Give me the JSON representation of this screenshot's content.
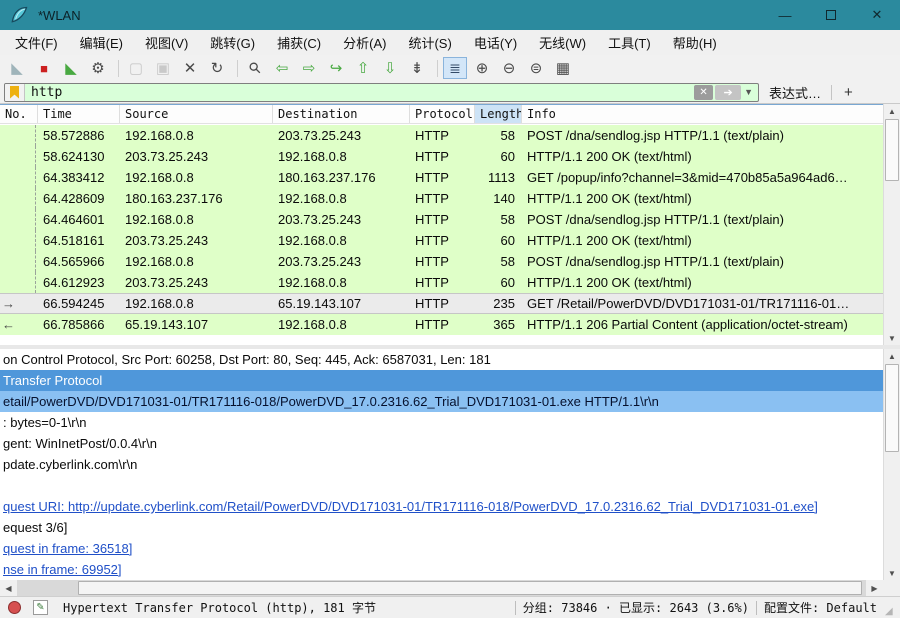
{
  "window": {
    "title": "*WLAN",
    "minimize": "—",
    "close": "✕"
  },
  "menu": {
    "items": [
      {
        "name": "menu-file",
        "label": "文件(F)"
      },
      {
        "name": "menu-edit",
        "label": "编辑(E)"
      },
      {
        "name": "menu-view",
        "label": "视图(V)"
      },
      {
        "name": "menu-go",
        "label": "跳转(G)"
      },
      {
        "name": "menu-capture",
        "label": "捕获(C)"
      },
      {
        "name": "menu-analyze",
        "label": "分析(A)"
      },
      {
        "name": "menu-statistics",
        "label": "统计(S)"
      },
      {
        "name": "menu-telephony",
        "label": "电话(Y)"
      },
      {
        "name": "menu-wireless",
        "label": "无线(W)"
      },
      {
        "name": "menu-tools",
        "label": "工具(T)"
      },
      {
        "name": "menu-help",
        "label": "帮助(H)"
      }
    ]
  },
  "toolbar": {
    "icons": [
      {
        "name": "start-capture-icon",
        "glyph": "◣",
        "classes": [
          "tint-muted"
        ]
      },
      {
        "name": "stop-capture-icon",
        "glyph": "■",
        "classes": [
          "tint-red"
        ]
      },
      {
        "name": "restart-capture-icon",
        "glyph": "◣",
        "classes": [
          "tint-green"
        ]
      },
      {
        "name": "capture-options-icon",
        "glyph": "⚙",
        "classes": [
          "tint-dark"
        ]
      },
      {
        "name": "toolbar-separator",
        "glyph": "",
        "classes": [
          "sep"
        ],
        "interactable": false
      },
      {
        "name": "open-file-icon",
        "glyph": "▢",
        "classes": [
          "disabled"
        ]
      },
      {
        "name": "save-file-icon",
        "glyph": "▣",
        "classes": [
          "disabled"
        ]
      },
      {
        "name": "close-file-icon",
        "glyph": "✕",
        "classes": [
          "tint-dark"
        ]
      },
      {
        "name": "reload-file-icon",
        "glyph": "↻",
        "classes": [
          "tint-dark"
        ]
      },
      {
        "name": "toolbar-separator",
        "glyph": "",
        "classes": [
          "sep"
        ],
        "interactable": false
      },
      {
        "name": "find-packet-icon",
        "glyph": "⚲",
        "classes": [
          "tint-dark"
        ]
      },
      {
        "name": "go-back-icon",
        "glyph": "⇦",
        "classes": [
          "tint-green"
        ]
      },
      {
        "name": "go-forward-icon",
        "glyph": "⇨",
        "classes": [
          "tint-green"
        ]
      },
      {
        "name": "go-to-packet-icon",
        "glyph": "↪",
        "classes": [
          "tint-green"
        ]
      },
      {
        "name": "go-up-icon",
        "glyph": "⇧",
        "classes": [
          "tint-green"
        ]
      },
      {
        "name": "go-down-icon",
        "glyph": "⇩",
        "classes": [
          "tint-green"
        ]
      },
      {
        "name": "go-bottom-icon",
        "glyph": "⇟",
        "classes": [
          "tint-dark"
        ]
      },
      {
        "name": "toolbar-separator",
        "glyph": "",
        "classes": [
          "sep"
        ],
        "interactable": false
      },
      {
        "name": "colorize-icon",
        "glyph": "≣",
        "classes": [
          "selected"
        ]
      },
      {
        "name": "zoom-in-icon",
        "glyph": "⊕",
        "classes": [
          "tint-dark"
        ]
      },
      {
        "name": "zoom-out-icon",
        "glyph": "⊖",
        "classes": [
          "tint-dark"
        ]
      },
      {
        "name": "zoom-reset-icon",
        "glyph": "⊜",
        "classes": [
          "tint-dark"
        ]
      },
      {
        "name": "resize-columns-icon",
        "glyph": "▦",
        "classes": [
          "tint-dark"
        ]
      }
    ]
  },
  "filter": {
    "value": "http",
    "clear_glyph": "✕",
    "apply_glyph": "➔",
    "caret_glyph": "▼",
    "expression_label": "表达式…",
    "add_label": "+"
  },
  "packet_list": {
    "columns": [
      "No.",
      "Time",
      "Source",
      "Destination",
      "Protocol",
      "Length",
      "Info"
    ],
    "rows": [
      {
        "marker": "",
        "classes": [
          "dashed"
        ],
        "time": "58.572886",
        "source": "192.168.0.8",
        "destination": "203.73.25.243",
        "protocol": "HTTP",
        "length": "58",
        "info": "POST /dna/sendlog.jsp HTTP/1.1  (text/plain)"
      },
      {
        "marker": "",
        "classes": [
          "dashed"
        ],
        "time": "58.624130",
        "source": "203.73.25.243",
        "destination": "192.168.0.8",
        "protocol": "HTTP",
        "length": "60",
        "info": "HTTP/1.1 200 OK  (text/html)"
      },
      {
        "marker": "",
        "classes": [
          "dashed"
        ],
        "time": "64.383412",
        "source": "192.168.0.8",
        "destination": "180.163.237.176",
        "protocol": "HTTP",
        "length": "1113",
        "info": "GET /popup/info?channel=3&mid=470b85a5a964ad6…"
      },
      {
        "marker": "",
        "classes": [
          "dashed"
        ],
        "time": "64.428609",
        "source": "180.163.237.176",
        "destination": "192.168.0.8",
        "protocol": "HTTP",
        "length": "140",
        "info": "HTTP/1.1 200 OK  (text/html)"
      },
      {
        "marker": "",
        "classes": [
          "dashed"
        ],
        "time": "64.464601",
        "source": "192.168.0.8",
        "destination": "203.73.25.243",
        "protocol": "HTTP",
        "length": "58",
        "info": "POST /dna/sendlog.jsp HTTP/1.1  (text/plain)"
      },
      {
        "marker": "",
        "classes": [
          "dashed"
        ],
        "time": "64.518161",
        "source": "203.73.25.243",
        "destination": "192.168.0.8",
        "protocol": "HTTP",
        "length": "60",
        "info": "HTTP/1.1 200 OK  (text/html)"
      },
      {
        "marker": "",
        "classes": [
          "dashed"
        ],
        "time": "64.565966",
        "source": "192.168.0.8",
        "destination": "203.73.25.243",
        "protocol": "HTTP",
        "length": "58",
        "info": "POST /dna/sendlog.jsp HTTP/1.1  (text/plain)"
      },
      {
        "marker": "",
        "classes": [
          "dashed"
        ],
        "time": "64.612923",
        "source": "203.73.25.243",
        "destination": "192.168.0.8",
        "protocol": "HTTP",
        "length": "60",
        "info": "HTTP/1.1 200 OK  (text/html)"
      },
      {
        "marker": "→",
        "classes": [
          "selected"
        ],
        "time": "66.594245",
        "source": "192.168.0.8",
        "destination": "65.19.143.107",
        "protocol": "HTTP",
        "length": "235",
        "info": "GET /Retail/PowerDVD/DVD171031-01/TR171116-01…"
      },
      {
        "marker": "←",
        "classes": [],
        "time": "66.785866",
        "source": "65.19.143.107",
        "destination": "192.168.0.8",
        "protocol": "HTTP",
        "length": "365",
        "info": "HTTP/1.1 206 Partial Content  (application/octet-stream)"
      }
    ]
  },
  "details": {
    "lines": [
      {
        "classes": [],
        "text": "on Control Protocol, Src Port: 60258, Dst Port: 80, Seq: 445, Ack: 6587031, Len: 181"
      },
      {
        "classes": [
          "sel"
        ],
        "text": "Transfer Protocol"
      },
      {
        "classes": [
          "hl"
        ],
        "text": "etail/PowerDVD/DVD171031-01/TR171116-018/PowerDVD_17.0.2316.62_Trial_DVD171031-01.exe HTTP/1.1\\r\\n"
      },
      {
        "classes": [],
        "text": ": bytes=0-1\\r\\n"
      },
      {
        "classes": [],
        "text": "gent: WinInetPost/0.0.4\\r\\n"
      },
      {
        "classes": [],
        "text": "pdate.cyberlink.com\\r\\n"
      },
      {
        "classes": [],
        "text": ""
      },
      {
        "classes": [
          "link"
        ],
        "text": "quest URI: http://update.cyberlink.com/Retail/PowerDVD/DVD171031-01/TR171116-018/PowerDVD_17.0.2316.62_Trial_DVD171031-01.exe]"
      },
      {
        "classes": [],
        "text": "equest 3/6]"
      },
      {
        "classes": [
          "link"
        ],
        "text": "quest in frame: 36518]"
      },
      {
        "classes": [
          "link"
        ],
        "text": "nse in frame: 69952]"
      }
    ]
  },
  "status_bar": {
    "edit_glyph": "✎",
    "left_text": "Hypertext Transfer Protocol (http), 181 字节",
    "counts": "分组: 73846  ·  已显示: 2643 (3.6%)",
    "profile": "配置文件: Default"
  },
  "colors": {
    "titlebar": "#2b8a9e",
    "filter_valid_green": "#d9ffd9",
    "http_row_green": "#dfffc8",
    "selected_detail_blue": "#4f97da",
    "highlight_detail_blue": "#8ac0f2",
    "link_blue": "#2050c8",
    "sorted_column_blue": "#cde3f6"
  }
}
